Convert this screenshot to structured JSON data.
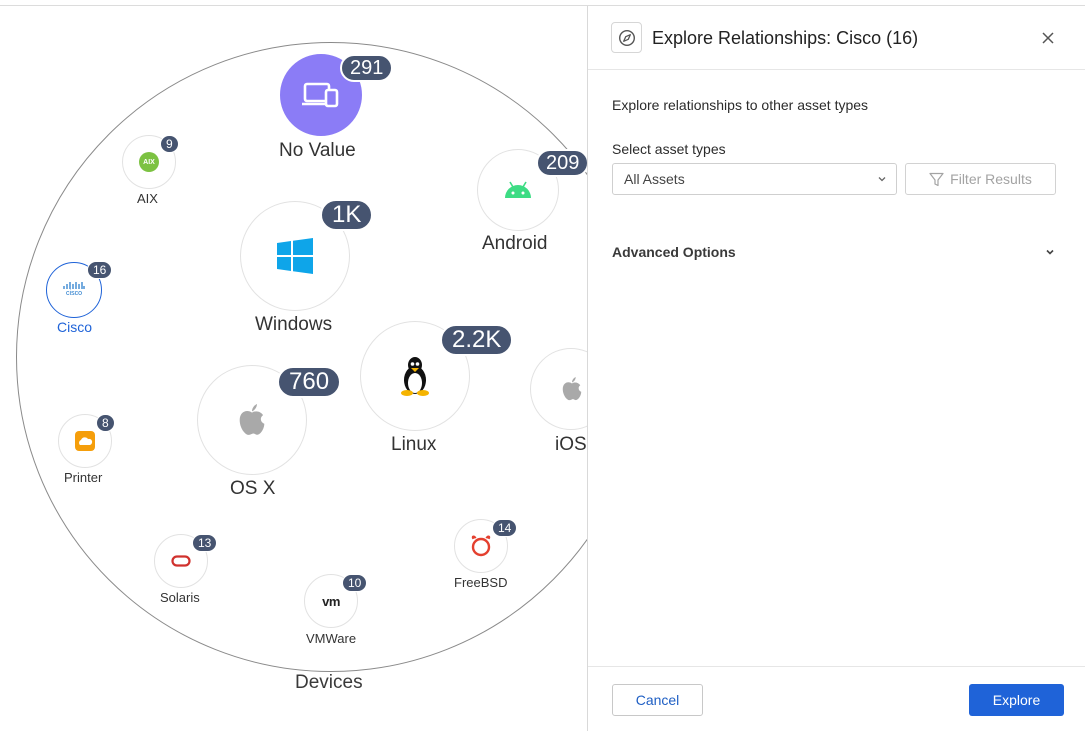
{
  "graph": {
    "group_label": "Devices",
    "nodes": [
      {
        "label": "No Value",
        "count": "291",
        "icon": "devices-icon"
      },
      {
        "label": "AIX",
        "count": "9",
        "icon": "aix-logo-icon"
      },
      {
        "label": "Android",
        "count": "209",
        "icon": "android-icon"
      },
      {
        "label": "Windows",
        "count": "1K",
        "icon": "windows-icon"
      },
      {
        "label": "Cisco",
        "count": "16",
        "icon": "cisco-logo-icon"
      },
      {
        "label": "Linux",
        "count": "2.2K",
        "icon": "linux-tux-icon"
      },
      {
        "label": "iOS",
        "count": "",
        "icon": "apple-icon"
      },
      {
        "label": "OS X",
        "count": "760",
        "icon": "apple-icon"
      },
      {
        "label": "Printer",
        "count": "8",
        "icon": "printer-icon"
      },
      {
        "label": "Solaris",
        "count": "13",
        "icon": "oracle-icon"
      },
      {
        "label": "FreeBSD",
        "count": "14",
        "icon": "freebsd-icon"
      },
      {
        "label": "VMWare",
        "count": "10",
        "icon": "vmware-icon"
      }
    ],
    "cisco_logo_text": "cisco",
    "aix_logo_text": "AIX",
    "vmware_logo_text": "vm"
  },
  "panel": {
    "title": "Explore Relationships: Cisco (16)",
    "intro": "Explore relationships to other asset types",
    "select_label": "Select asset types",
    "select_value": "All Assets",
    "filter_button": "Filter Results",
    "advanced_options": "Advanced Options",
    "cancel": "Cancel",
    "explore": "Explore"
  },
  "colors": {
    "badge": "#465470",
    "no_value_fill": "#8b7cf6",
    "selected": "#1f63d8",
    "primary_button": "#1f63d8"
  }
}
